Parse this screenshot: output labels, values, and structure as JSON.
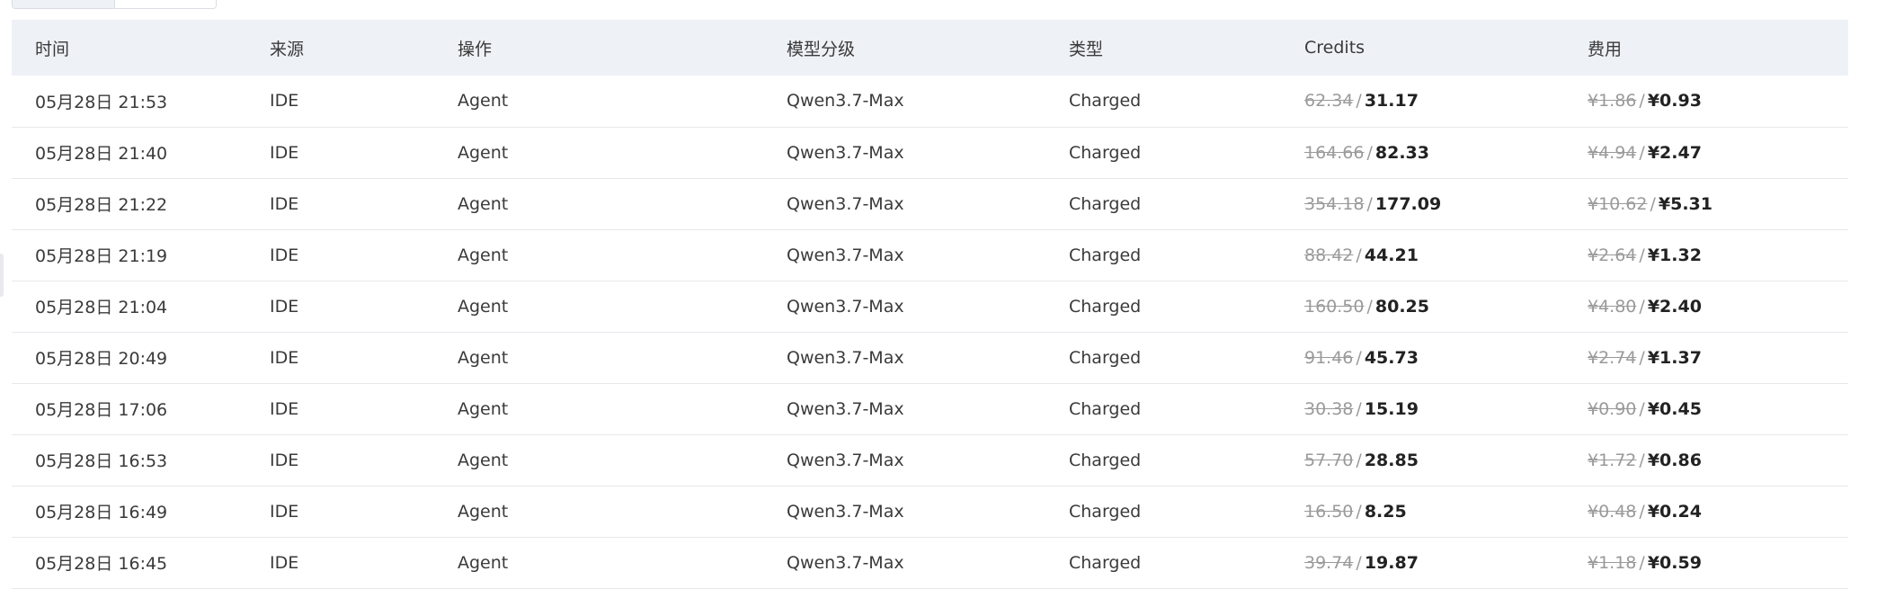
{
  "tabs": [
    {
      "label": ""
    },
    {
      "label": ""
    }
  ],
  "table": {
    "headers": [
      "时间",
      "来源",
      "操作",
      "模型分级",
      "类型",
      "Credits",
      "费用"
    ],
    "rows": [
      {
        "time": "05月28日 21:53",
        "source": "IDE",
        "operation": "Agent",
        "model": "Qwen3.7-Max",
        "type": "Charged",
        "credits_original": "62.34",
        "credits_actual": "31.17",
        "fee_original": "¥1.86",
        "fee_actual": "¥0.93"
      },
      {
        "time": "05月28日 21:40",
        "source": "IDE",
        "operation": "Agent",
        "model": "Qwen3.7-Max",
        "type": "Charged",
        "credits_original": "164.66",
        "credits_actual": "82.33",
        "fee_original": "¥4.94",
        "fee_actual": "¥2.47"
      },
      {
        "time": "05月28日 21:22",
        "source": "IDE",
        "operation": "Agent",
        "model": "Qwen3.7-Max",
        "type": "Charged",
        "credits_original": "354.18",
        "credits_actual": "177.09",
        "fee_original": "¥10.62",
        "fee_actual": "¥5.31"
      },
      {
        "time": "05月28日 21:19",
        "source": "IDE",
        "operation": "Agent",
        "model": "Qwen3.7-Max",
        "type": "Charged",
        "credits_original": "88.42",
        "credits_actual": "44.21",
        "fee_original": "¥2.64",
        "fee_actual": "¥1.32"
      },
      {
        "time": "05月28日 21:04",
        "source": "IDE",
        "operation": "Agent",
        "model": "Qwen3.7-Max",
        "type": "Charged",
        "credits_original": "160.50",
        "credits_actual": "80.25",
        "fee_original": "¥4.80",
        "fee_actual": "¥2.40"
      },
      {
        "time": "05月28日 20:49",
        "source": "IDE",
        "operation": "Agent",
        "model": "Qwen3.7-Max",
        "type": "Charged",
        "credits_original": "91.46",
        "credits_actual": "45.73",
        "fee_original": "¥2.74",
        "fee_actual": "¥1.37"
      },
      {
        "time": "05月28日 17:06",
        "source": "IDE",
        "operation": "Agent",
        "model": "Qwen3.7-Max",
        "type": "Charged",
        "credits_original": "30.38",
        "credits_actual": "15.19",
        "fee_original": "¥0.90",
        "fee_actual": "¥0.45"
      },
      {
        "time": "05月28日 16:53",
        "source": "IDE",
        "operation": "Agent",
        "model": "Qwen3.7-Max",
        "type": "Charged",
        "credits_original": "57.70",
        "credits_actual": "28.85",
        "fee_original": "¥1.72",
        "fee_actual": "¥0.86"
      },
      {
        "time": "05月28日 16:49",
        "source": "IDE",
        "operation": "Agent",
        "model": "Qwen3.7-Max",
        "type": "Charged",
        "credits_original": "16.50",
        "credits_actual": "8.25",
        "fee_original": "¥0.48",
        "fee_actual": "¥0.24"
      },
      {
        "time": "05月28日 16:45",
        "source": "IDE",
        "operation": "Agent",
        "model": "Qwen3.7-Max",
        "type": "Charged",
        "credits_original": "39.74",
        "credits_actual": "19.87",
        "fee_original": "¥1.18",
        "fee_actual": "¥0.59"
      }
    ]
  }
}
